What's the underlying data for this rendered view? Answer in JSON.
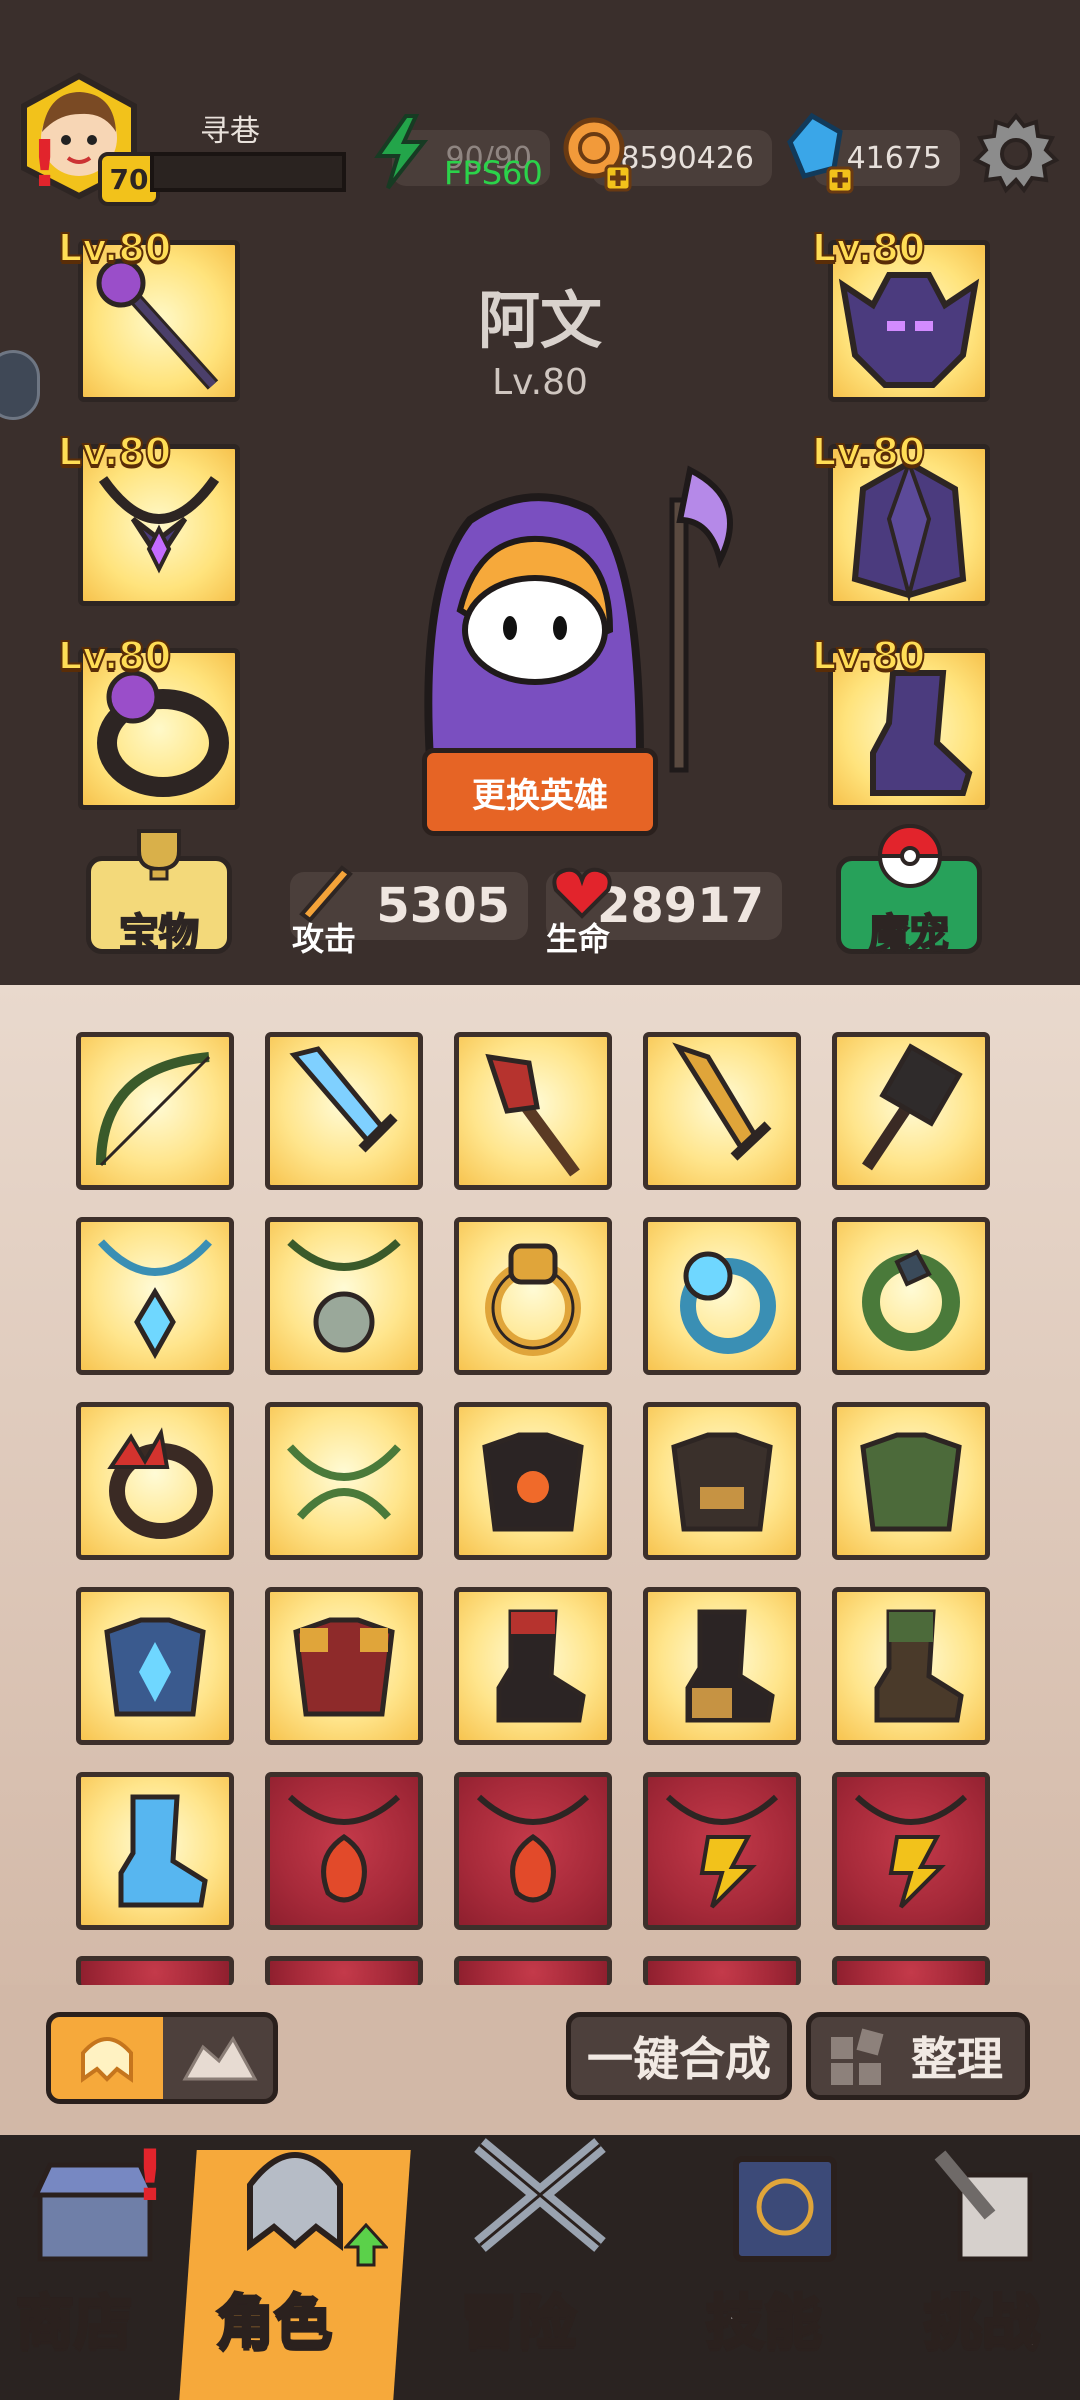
{
  "player": {
    "name": "寻巷",
    "level": "70"
  },
  "resources": {
    "energy": "90/90",
    "fps": "FPS60",
    "coins": "8590426",
    "gems": "41675"
  },
  "hero": {
    "name": "阿文",
    "level": "Lv.80",
    "change_button": "更换英雄"
  },
  "equipment_slots": [
    {
      "level": "Lv.80",
      "item": "staff-icon"
    },
    {
      "level": "Lv.80",
      "item": "bat-helmet-icon"
    },
    {
      "level": "Lv.80",
      "item": "amulet-icon"
    },
    {
      "level": "Lv.80",
      "item": "cloak-armor-icon"
    },
    {
      "level": "Lv.80",
      "item": "ring-icon"
    },
    {
      "level": "Lv.80",
      "item": "boots-icon"
    }
  ],
  "stats": {
    "attack_label": "攻击",
    "attack_value": "5305",
    "hp_label": "生命",
    "hp_value": "28917"
  },
  "side_buttons": {
    "treasure": "宝物",
    "pet": "魔宠"
  },
  "toolbar": {
    "merge_all": "一键合成",
    "sort": "整理"
  },
  "nav": [
    {
      "label": "商店",
      "active": false
    },
    {
      "label": "角色",
      "active": true
    },
    {
      "label": "冒险",
      "active": false
    },
    {
      "label": "技能",
      "active": false
    },
    {
      "label": "挑战",
      "active": false
    }
  ],
  "colors": {
    "accent_orange": "#f6a93b",
    "badge_red": "#e2242c",
    "panel_dark": "#3a2f2c"
  }
}
